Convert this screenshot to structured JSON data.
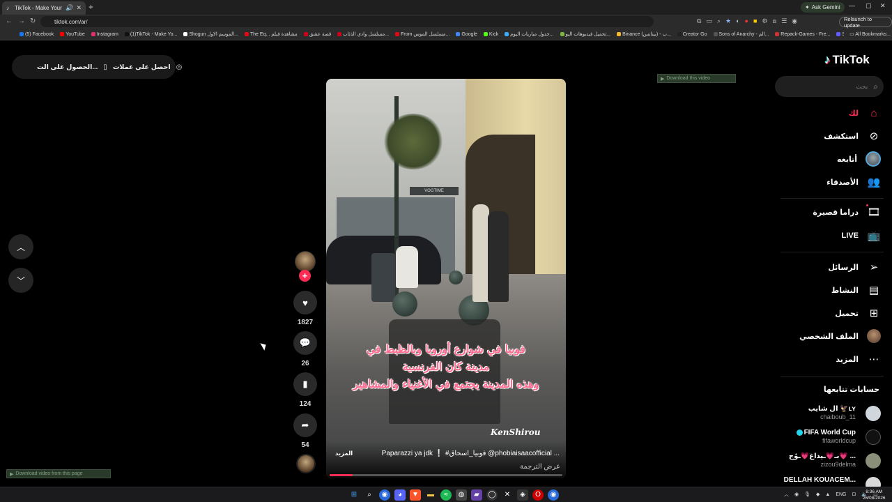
{
  "browser": {
    "tab_title": "TikTok - Make Your Day",
    "tab_icon": "tiktok-favicon",
    "url": "tiktok.com/ar/",
    "ask_gemini": "Ask Gemini",
    "relaunch": "Relaunch to update",
    "all_bookmarks": "All Bookmarks",
    "bookmarks": [
      {
        "label": "(5) Facebook",
        "color": "#1877f2"
      },
      {
        "label": "YouTube",
        "color": "#ff0000"
      },
      {
        "label": "Instagram",
        "color": "#e1306c"
      },
      {
        "label": "(1)TikTok - Make Yo...",
        "color": "#111111"
      },
      {
        "label": "Shogun الموسم الاول...",
        "color": "#ffffff"
      },
      {
        "label": "The Eq... مشاهدة فيلم",
        "color": "#e50914"
      },
      {
        "label": "قصة عشق",
        "color": "#d0021b"
      },
      {
        "label": "مسلسل وادي الذئاب...",
        "color": "#d0021b"
      },
      {
        "label": "From مسلسل الموس...",
        "color": "#e50914"
      },
      {
        "label": "Google",
        "color": "#4285f4"
      },
      {
        "label": "Kick",
        "color": "#53fc18"
      },
      {
        "label": "جدول مباريات اليوم...",
        "color": "#3fa9f5"
      },
      {
        "label": "تحميل فيديوهات اليو...",
        "color": "#7cb342"
      },
      {
        "label": "Binance (بينانس) - ب...",
        "color": "#f3ba2f"
      },
      {
        "label": "Creator Go",
        "color": "#222222"
      },
      {
        "label": "Sons of Anarchy - الم...",
        "color": "#555555"
      },
      {
        "label": "Repack-Games - Fre...",
        "color": "#cc3333"
      },
      {
        "label": "Stripe | Financial Infr...",
        "color": "#635bff"
      }
    ]
  },
  "top_pill": {
    "get_coins": "احصل على عملات",
    "get_app": "الحصول على الت..."
  },
  "download_bar": "Download this video",
  "download_bar_bottom": "Download video from this page",
  "video": {
    "caption_overlay": [
      "فوبيا في شوارع أوروبا وبالظبط في",
      "مدينة كان الفرنسية",
      "وهذه المدينة يجتمع في الأغنياء والمشاهير"
    ],
    "watermark": "KenShirou",
    "shop_sign": "VOGTIME",
    "description": "Paparazzi ya jdk  ❕ #فوبيا_اسحاق @phobiaisaacofficial ...",
    "more": "المزيد",
    "translate": "عرض الترجمة",
    "progress": 0.1
  },
  "actions": {
    "likes": "1827",
    "comments": "26",
    "saves": "124",
    "shares": "54"
  },
  "sidebar": {
    "logo": "TikTok",
    "search_placeholder": "بحث",
    "items": [
      {
        "label": "لك",
        "icon": "home-icon"
      },
      {
        "label": "استكشف",
        "icon": "compass-icon"
      },
      {
        "label": "أتابعه",
        "icon": "avatar"
      },
      {
        "label": "الأصدقاء",
        "icon": "friends-icon"
      },
      {
        "label": "دراما قصيرة",
        "icon": "film-icon"
      },
      {
        "label": "LIVE",
        "icon": "live-icon"
      },
      {
        "label": "الرسائل",
        "icon": "send-icon"
      },
      {
        "label": "النشاط",
        "icon": "activity-icon"
      },
      {
        "label": "تحميل",
        "icon": "upload-icon"
      },
      {
        "label": "الملف الشخصي",
        "icon": "profile-avatar"
      },
      {
        "label": "المزيد",
        "icon": "more-icon"
      }
    ],
    "following_title": "حسابات تتابعها",
    "accounts": [
      {
        "name": "ال شايب 🦅ʟʏ",
        "user": "chaiboub_11",
        "avatar_color": "#cfd6dc"
      },
      {
        "name": "FIFA World Cup",
        "user": "fifaworldcup",
        "avatar_color": "#111111",
        "verified": true
      },
      {
        "name": "بـ💗ـيداغ💗ـوُج💗 ...",
        "user": "zizou9delma",
        "avatar_color": "#8a8f7a"
      },
      {
        "name": "DELLAH KOUACEM...",
        "user": "",
        "avatar_color": "#d8d8d8"
      }
    ]
  },
  "taskbar": {
    "lang": "ENG",
    "time": "8:36 AM",
    "date": "26/08/2026"
  }
}
